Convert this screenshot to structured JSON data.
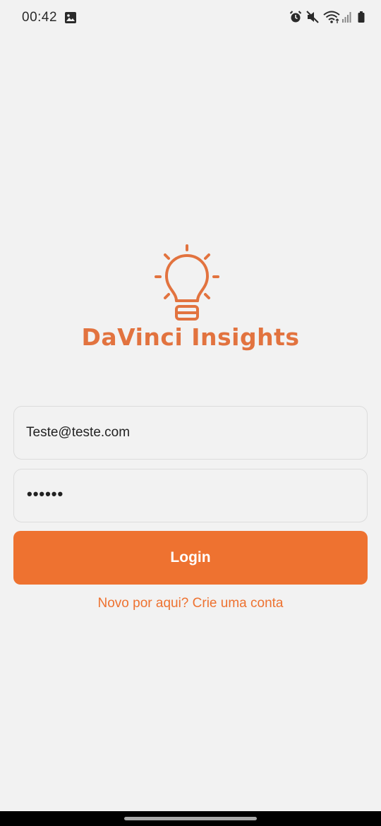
{
  "status_bar": {
    "time": "00:42",
    "left_icons": [
      "image-icon"
    ],
    "right_icons": [
      "alarm-icon",
      "mute-icon",
      "wifi-icon",
      "signal-icon",
      "battery-icon"
    ]
  },
  "brand": {
    "name": "DaVinci Insights",
    "icon": "lightbulb-icon"
  },
  "login_form": {
    "email_value": "Teste@teste.com",
    "password_masked": "••••••",
    "login_label": "Login",
    "signup_text": "Novo por aqui? Crie uma conta"
  },
  "colors": {
    "accent": "#ee7230",
    "logo": "#e2733f",
    "background": "#f2f2f2"
  }
}
